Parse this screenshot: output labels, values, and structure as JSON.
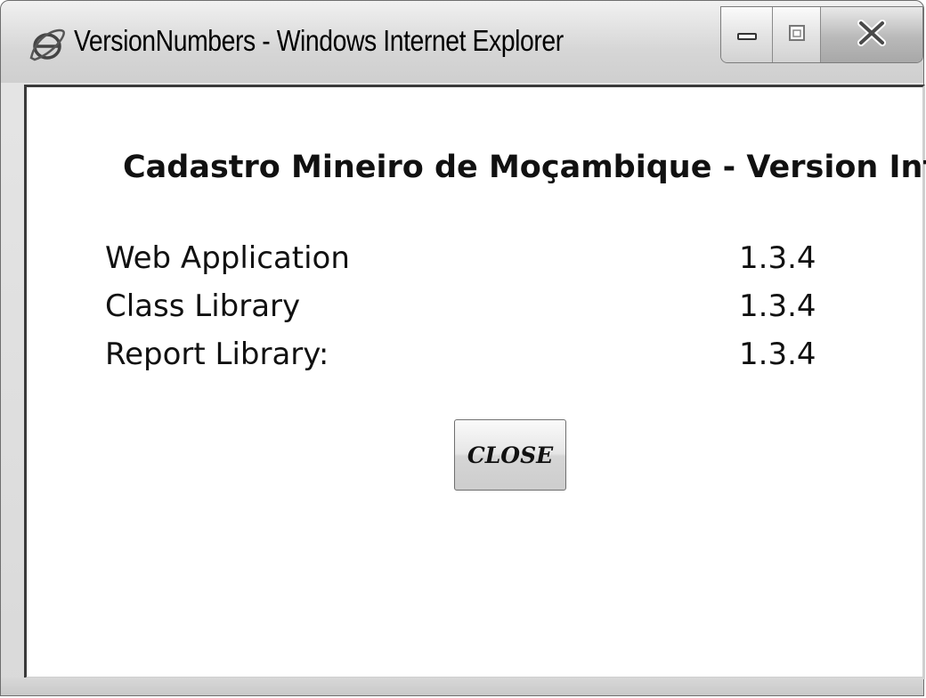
{
  "window": {
    "title": "VersionNumbers - Windows Internet Explorer",
    "icon": "internet-explorer-icon",
    "controls": [
      "minimize-icon",
      "maximize-icon",
      "close-icon"
    ]
  },
  "content": {
    "heading": "Cadastro Mineiro de Moçambique - Version Info",
    "rows": [
      {
        "label": "Web Application",
        "value": "1.3.4"
      },
      {
        "label": "Class Library",
        "value": "1.3.4"
      },
      {
        "label": "Report Library:",
        "value": "1.3.4"
      }
    ],
    "close_button_label": "CLOSE"
  },
  "colors": {
    "background": "#ffffff",
    "frame": "#d9d9d9",
    "text": "#111111"
  }
}
